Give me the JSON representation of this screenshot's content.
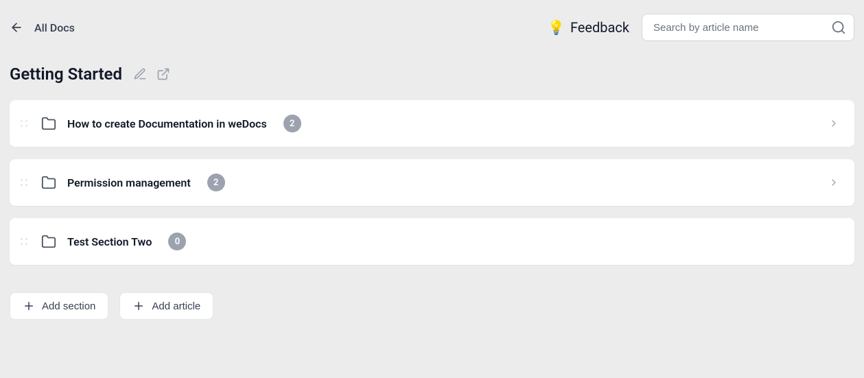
{
  "header": {
    "back_label": "All Docs",
    "feedback_label": "Feedback",
    "feedback_emoji": "💡",
    "search_placeholder": "Search by article name"
  },
  "page": {
    "title": "Getting Started"
  },
  "sections": [
    {
      "title": "How to create Documentation in weDocs",
      "count": "2",
      "has_chevron": true
    },
    {
      "title": "Permission management",
      "count": "2",
      "has_chevron": true
    },
    {
      "title": "Test Section Two",
      "count": "0",
      "has_chevron": false
    }
  ],
  "actions": {
    "add_section": "Add section",
    "add_article": "Add article"
  }
}
